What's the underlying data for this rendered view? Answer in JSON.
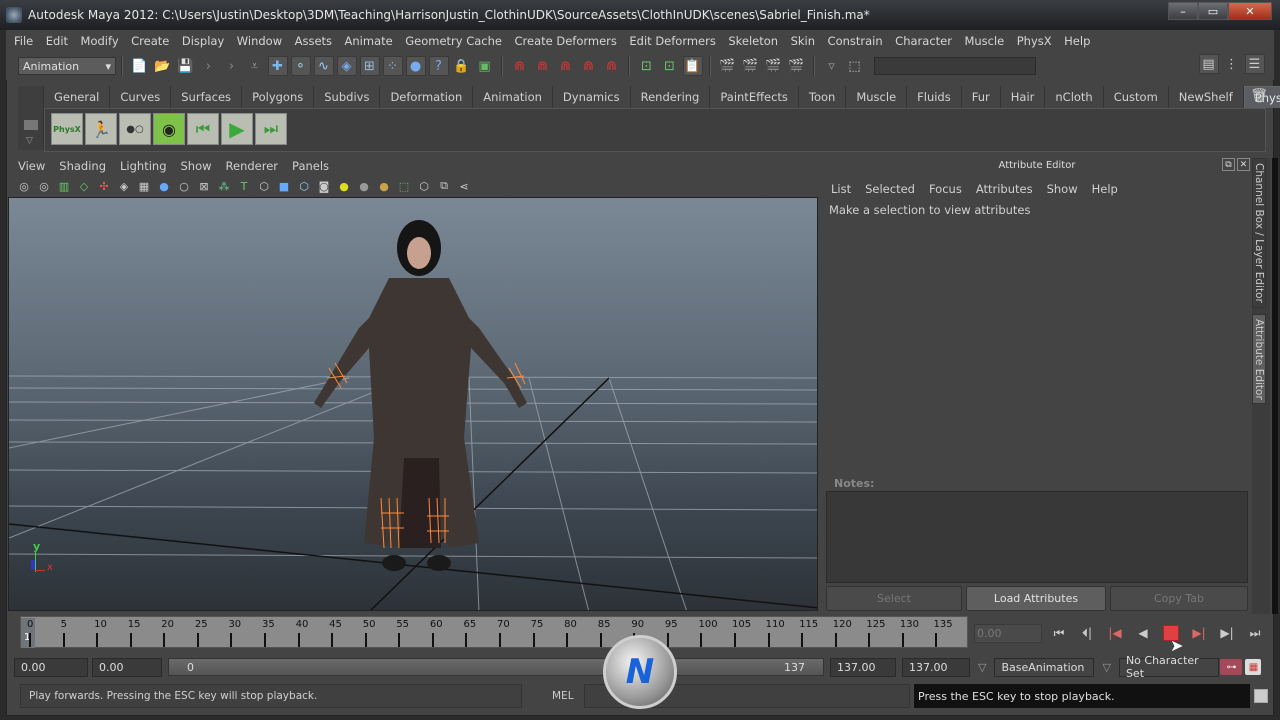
{
  "window": {
    "title": "Autodesk Maya 2012: C:\\Users\\Justin\\Desktop\\3DM\\Teaching\\HarrisonJustin_ClothinUDK\\SourceAssets\\ClothInUDK\\scenes\\Sabriel_Finish.ma*",
    "minimize": "–",
    "maximize": "▭",
    "close": "✕"
  },
  "menubar": [
    "File",
    "Edit",
    "Modify",
    "Create",
    "Display",
    "Window",
    "Assets",
    "Animate",
    "Geometry Cache",
    "Create Deformers",
    "Edit Deformers",
    "Skeleton",
    "Skin",
    "Constrain",
    "Character",
    "Muscle",
    "PhysX",
    "Help"
  ],
  "statusline": {
    "menuset": "Animation",
    "command_field": ""
  },
  "shelf": {
    "tabs": [
      "General",
      "Curves",
      "Surfaces",
      "Polygons",
      "Subdivs",
      "Deformation",
      "Animation",
      "Dynamics",
      "Rendering",
      "PaintEffects",
      "Toon",
      "Muscle",
      "Fluids",
      "Fur",
      "Hair",
      "nCloth",
      "Custom",
      "NewShelf",
      "PhysX"
    ],
    "active_tab": "PhysX",
    "icons": [
      {
        "name": "physx-logo-icon",
        "glyph": "PhysX"
      },
      {
        "name": "physx-run-icon",
        "glyph": "🏃"
      },
      {
        "name": "physx-particles-icon",
        "glyph": "●○"
      },
      {
        "name": "physx-camera-icon",
        "glyph": "◉"
      },
      {
        "name": "physx-rewind-icon",
        "glyph": "⏮"
      },
      {
        "name": "physx-play-icon",
        "glyph": "▶"
      },
      {
        "name": "physx-step-icon",
        "glyph": "⏭"
      }
    ]
  },
  "viewport": {
    "menu": [
      "View",
      "Shading",
      "Lighting",
      "Show",
      "Renderer",
      "Panels"
    ],
    "axis_y": "y",
    "axis_x": "x"
  },
  "attribute_editor": {
    "title": "Attribute Editor",
    "menu": [
      "List",
      "Selected",
      "Focus",
      "Attributes",
      "Show",
      "Help"
    ],
    "message": "Make a selection to view attributes",
    "notes_label": "Notes:",
    "notes_value": "",
    "buttons": {
      "select": "Select",
      "load": "Load Attributes",
      "copy": "Copy Tab"
    },
    "side_tabs": [
      "Channel Box / Layer Editor",
      "Attribute Editor"
    ]
  },
  "timeline": {
    "ticks": [
      0,
      5,
      10,
      15,
      20,
      25,
      30,
      35,
      40,
      45,
      50,
      55,
      60,
      65,
      70,
      75,
      80,
      85,
      90,
      95,
      100,
      105,
      110,
      115,
      120,
      125,
      130,
      135
    ],
    "current_frame": "1",
    "current_time": "0.00",
    "min": 0,
    "max": 137
  },
  "range": {
    "start": "0.00",
    "playback_start": "0.00",
    "slider_min_label": "0",
    "slider_max_label": "137",
    "playback_end": "137.00",
    "end": "137.00",
    "anim_layer": "BaseAnimation",
    "character_set": "No Character Set"
  },
  "commandline": {
    "help": "Play forwards. Pressing the ESC key will stop playback.",
    "language": "MEL",
    "input": "",
    "result": "Press the ESC key to stop playback."
  },
  "watermark": "N",
  "colors": {
    "accent_stop": "#e04040",
    "viewport_top": "#7b8895",
    "viewport_bottom": "#2c3238",
    "wire_highlight": "#ff8a3a"
  }
}
